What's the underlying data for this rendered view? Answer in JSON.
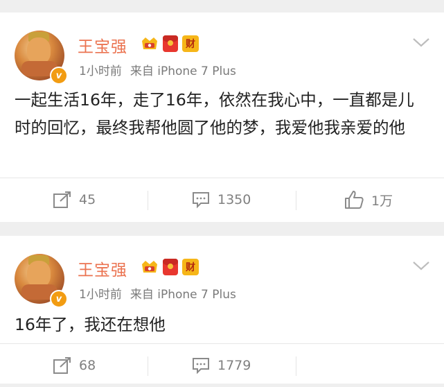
{
  "posts": [
    {
      "author": "王宝强",
      "badges": [
        "crown-badge",
        "red-packet-badge",
        "cai-badge"
      ],
      "cai_badge_text": "财",
      "verified_icon": "v-verified-icon",
      "time": "1小时前",
      "source": "来自 iPhone 7 Plus",
      "text": "一起生活16年，走了16年，依然在我心中，一直都是儿时的回忆，最终我帮他圆了他的梦，我爱他我亲爱的他",
      "actions": {
        "repost": "45",
        "comment": "1350",
        "like": "1万"
      }
    },
    {
      "author": "王宝强",
      "badges": [
        "crown-badge",
        "red-packet-badge",
        "cai-badge"
      ],
      "cai_badge_text": "财",
      "verified_icon": "v-verified-icon",
      "time": "1小时前",
      "source": "来自 iPhone 7 Plus",
      "text": "16年了，我还在想他",
      "actions": {
        "repost": "68",
        "comment": "1779",
        "like": ""
      }
    }
  ],
  "colors": {
    "author_name": "#eb7350",
    "meta_text": "#7a7a7a",
    "body_text": "#222222",
    "action_text": "#808080",
    "page_bg": "#efefef"
  }
}
